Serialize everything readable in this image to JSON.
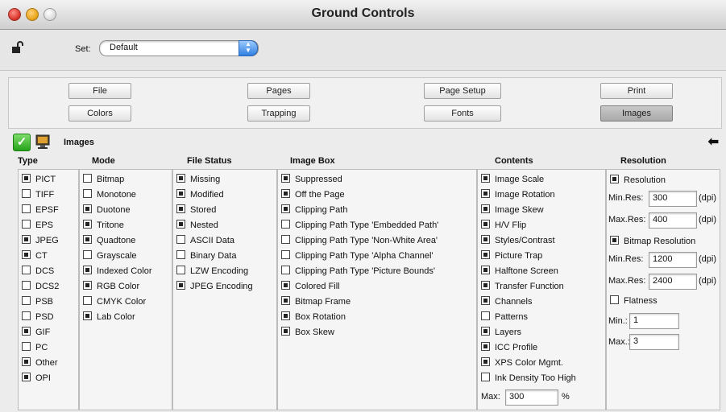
{
  "window": {
    "title": "Ground Controls"
  },
  "setbar": {
    "label": "Set:",
    "selected": "Default"
  },
  "tabs": [
    {
      "label": "File"
    },
    {
      "label": "Pages"
    },
    {
      "label": "Page Setup"
    },
    {
      "label": "Print"
    },
    {
      "label": "Colors"
    },
    {
      "label": "Trapping"
    },
    {
      "label": "Fonts"
    },
    {
      "label": "Images",
      "active": true
    }
  ],
  "section": {
    "title": "Images"
  },
  "columns": {
    "type": {
      "header": "Type",
      "items": [
        {
          "label": "PICT",
          "checked": true
        },
        {
          "label": "TIFF",
          "checked": false
        },
        {
          "label": "EPSF",
          "checked": false
        },
        {
          "label": "EPS",
          "checked": false
        },
        {
          "label": "JPEG",
          "checked": true
        },
        {
          "label": "CT",
          "checked": true
        },
        {
          "label": "DCS",
          "checked": false
        },
        {
          "label": "DCS2",
          "checked": false
        },
        {
          "label": "PSB",
          "checked": false
        },
        {
          "label": "PSD",
          "checked": false
        },
        {
          "label": "GIF",
          "checked": true
        },
        {
          "label": "PC",
          "checked": false
        },
        {
          "label": "Other",
          "checked": true
        },
        {
          "label": "OPI",
          "checked": true
        }
      ]
    },
    "mode": {
      "header": "Mode",
      "items": [
        {
          "label": "Bitmap",
          "checked": false
        },
        {
          "label": "Monotone",
          "checked": false
        },
        {
          "label": "Duotone",
          "checked": true
        },
        {
          "label": "Tritone",
          "checked": true
        },
        {
          "label": "Quadtone",
          "checked": true
        },
        {
          "label": "Grayscale",
          "checked": false
        },
        {
          "label": "Indexed Color",
          "checked": true
        },
        {
          "label": "RGB Color",
          "checked": true
        },
        {
          "label": "CMYK Color",
          "checked": false
        },
        {
          "label": "Lab Color",
          "checked": true
        }
      ]
    },
    "file_status": {
      "header": "File Status",
      "items": [
        {
          "label": "Missing",
          "checked": true
        },
        {
          "label": "Modified",
          "checked": true
        },
        {
          "label": "Stored",
          "checked": true
        },
        {
          "label": "Nested",
          "checked": true
        },
        {
          "label": "ASCII Data",
          "checked": false
        },
        {
          "label": "Binary Data",
          "checked": false
        },
        {
          "label": "LZW Encoding",
          "checked": false
        },
        {
          "label": "JPEG Encoding",
          "checked": true
        }
      ]
    },
    "image_box": {
      "header": "Image Box",
      "items": [
        {
          "label": "Suppressed",
          "checked": true
        },
        {
          "label": "Off the Page",
          "checked": true
        },
        {
          "label": "Clipping Path",
          "checked": true
        },
        {
          "label": "Clipping Path Type 'Embedded Path'",
          "checked": false
        },
        {
          "label": "Clipping Path Type 'Non-White Area'",
          "checked": false
        },
        {
          "label": "Clipping Path Type 'Alpha Channel'",
          "checked": false
        },
        {
          "label": "Clipping Path Type 'Picture Bounds'",
          "checked": false
        },
        {
          "label": "Colored Fill",
          "checked": true
        },
        {
          "label": "Bitmap Frame",
          "checked": true
        },
        {
          "label": "Box Rotation",
          "checked": true
        },
        {
          "label": "Box Skew",
          "checked": true
        }
      ]
    },
    "contents": {
      "header": "Contents",
      "items": [
        {
          "label": "Image Scale",
          "checked": true
        },
        {
          "label": "Image Rotation",
          "checked": true
        },
        {
          "label": "Image Skew",
          "checked": true
        },
        {
          "label": "H/V Flip",
          "checked": true
        },
        {
          "label": "Styles/Contrast",
          "checked": true
        },
        {
          "label": "Picture Trap",
          "checked": true
        },
        {
          "label": "Halftone Screen",
          "checked": true
        },
        {
          "label": "Transfer Function",
          "checked": true
        },
        {
          "label": "Channels",
          "checked": true
        },
        {
          "label": "Patterns",
          "checked": false
        },
        {
          "label": "Layers",
          "checked": true
        },
        {
          "label": "ICC Profile",
          "checked": true
        },
        {
          "label": "XPS Color Mgmt.",
          "checked": true
        },
        {
          "label": "Ink Density Too High",
          "checked": false
        }
      ],
      "max_label": "Max:",
      "max_value": "300",
      "max_unit": "%"
    },
    "resolution": {
      "header": "Resolution",
      "resolution_label": "Resolution",
      "resolution_checked": true,
      "min_res_label": "Min.Res:",
      "min_res_value": "300",
      "max_res_label": "Max.Res:",
      "max_res_value": "400",
      "dpi": "(dpi)",
      "bitmap_label": "Bitmap Resolution",
      "bitmap_checked": true,
      "bmin_value": "1200",
      "bmax_value": "2400",
      "flatness_label": "Flatness",
      "flatness_checked": false,
      "min_label": "Min.:",
      "min_value": "1",
      "max_label": "Max.:",
      "max_value": "3"
    }
  }
}
